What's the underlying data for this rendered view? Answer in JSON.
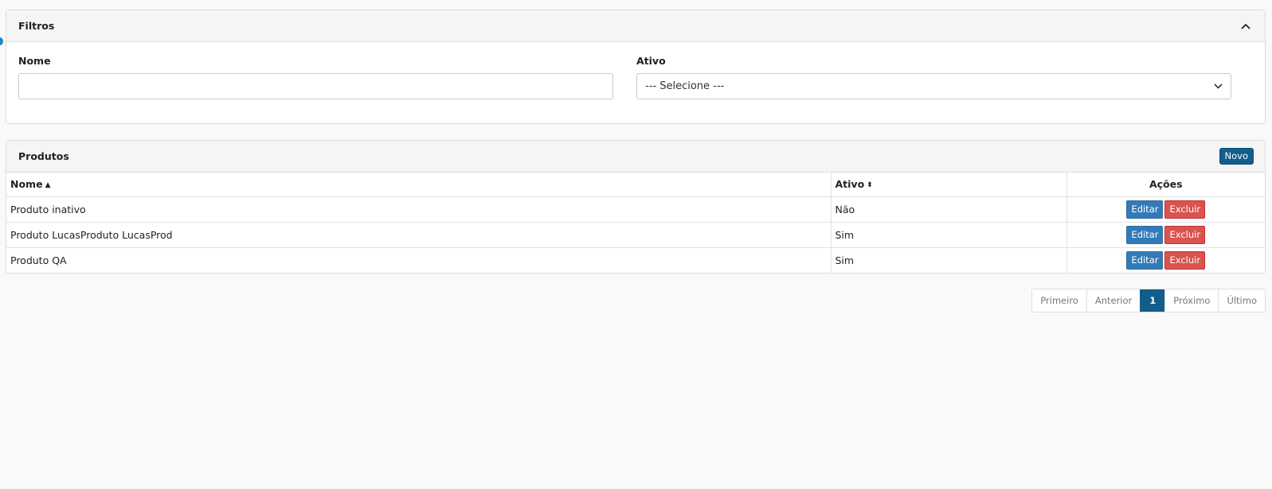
{
  "filters": {
    "title": "Filtros",
    "nome_label": "Nome",
    "nome_value": "",
    "ativo_label": "Ativo",
    "ativo_selected": "--- Selecione ---"
  },
  "products": {
    "title": "Produtos",
    "new_button": "Novo",
    "columns": {
      "nome": "Nome",
      "ativo": "Ativo",
      "acoes": "Ações"
    },
    "rows": [
      {
        "nome": "Produto inativo",
        "ativo": "Não",
        "edit": "Editar",
        "delete": "Excluir"
      },
      {
        "nome": "Produto LucasProduto LucasProd",
        "ativo": "Sim",
        "edit": "Editar",
        "delete": "Excluir"
      },
      {
        "nome": "Produto QA",
        "ativo": "Sim",
        "edit": "Editar",
        "delete": "Excluir"
      }
    ]
  },
  "pagination": {
    "first": "Primeiro",
    "previous": "Anterior",
    "current": "1",
    "next": "Próximo",
    "last": "Último"
  },
  "colors": {
    "primary": "#135d8a",
    "edit": "#337ab7",
    "delete": "#d9534f",
    "background": "#f9f9f9"
  }
}
